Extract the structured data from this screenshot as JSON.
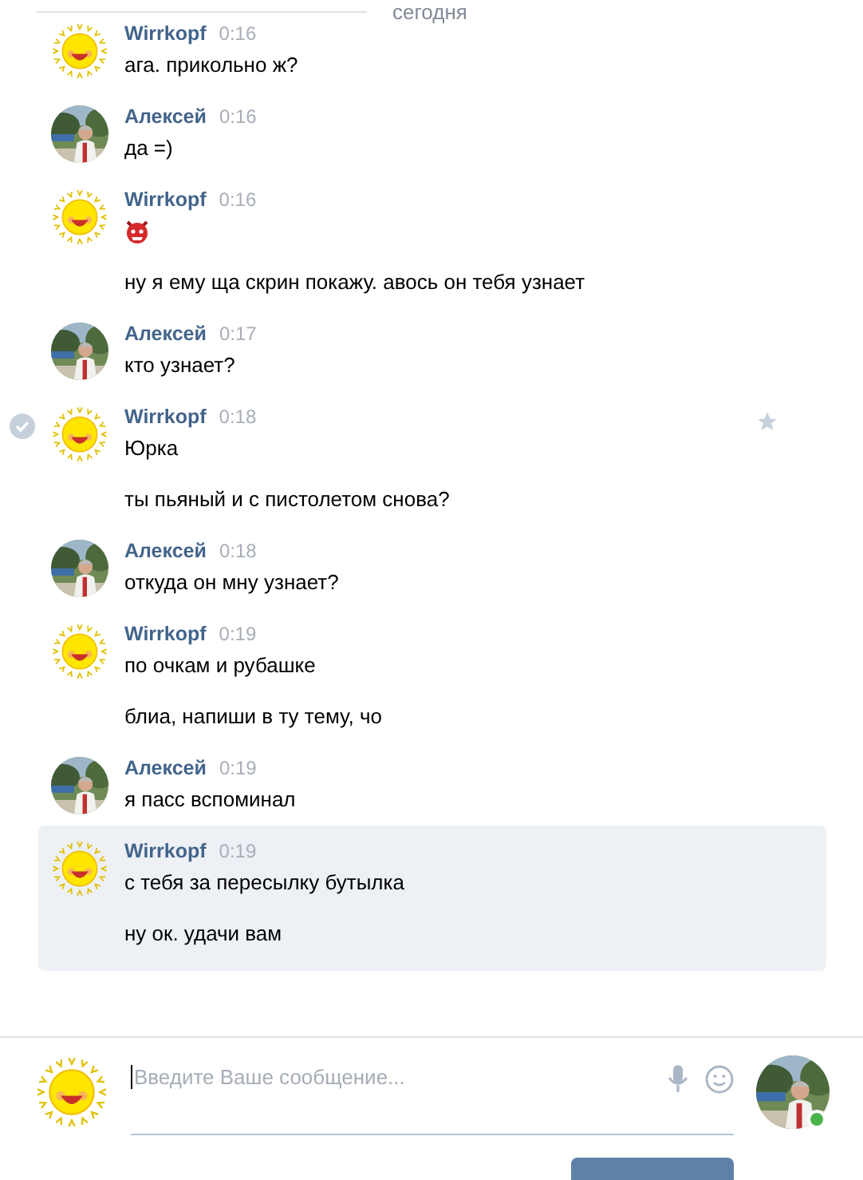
{
  "date_divider": "сегодня",
  "messages": [
    {
      "author": "Wirrkopf",
      "kind": "sun",
      "time": "0:16",
      "hovered": false,
      "unread": false,
      "lines": [
        {
          "kind": "text",
          "text": "ага. прикольно ж?"
        }
      ]
    },
    {
      "author": "Алексей",
      "time": "0:16",
      "hovered": false,
      "unread": false,
      "lines": [
        {
          "kind": "text",
          "text": "да =)"
        }
      ]
    },
    {
      "author": "Wirrkopf",
      "kind": "sun",
      "time": "0:16",
      "hovered": false,
      "unread": false,
      "lines": [
        {
          "kind": "emoji"
        },
        {
          "kind": "text",
          "text": "ну я ему ща скрин покажу. авось он тебя узнает"
        }
      ]
    },
    {
      "author": "Алексей",
      "time": "0:17",
      "hovered": false,
      "unread": false,
      "lines": [
        {
          "kind": "text",
          "text": "кто узнает?"
        }
      ]
    },
    {
      "author": "Wirrkopf",
      "kind": "sun",
      "time": "0:18",
      "hovered": true,
      "unread": false,
      "lines": [
        {
          "kind": "text",
          "text": "Юрка"
        },
        {
          "kind": "text",
          "text": "ты пьяный и с пистолетом снова?"
        }
      ]
    },
    {
      "author": "Алексей",
      "time": "0:18",
      "hovered": false,
      "unread": false,
      "lines": [
        {
          "kind": "text",
          "text": "откуда он мну узнает?"
        }
      ]
    },
    {
      "author": "Wirrkopf",
      "kind": "sun",
      "time": "0:19",
      "hovered": false,
      "unread": false,
      "lines": [
        {
          "kind": "text",
          "text": "по очкам и рубашке"
        },
        {
          "kind": "text",
          "text": "блиа, напиши в ту тему, чо"
        }
      ]
    },
    {
      "author": "Алексей",
      "time": "0:19",
      "hovered": false,
      "unread": false,
      "lines": [
        {
          "kind": "text",
          "text": "я пасс вспоминал"
        }
      ]
    },
    {
      "author": "Wirrkopf",
      "kind": "sun",
      "time": "0:19",
      "hovered": false,
      "unread": true,
      "lines": [
        {
          "kind": "text",
          "text": "с тебя за пересылку бутылка"
        },
        {
          "kind": "text",
          "text": "ну ок. удачи вам"
        }
      ]
    }
  ],
  "composer": {
    "my_avatar": {
      "kind": "sun"
    },
    "placeholder": "Введите Ваше сообщение...",
    "peer_online": true
  }
}
